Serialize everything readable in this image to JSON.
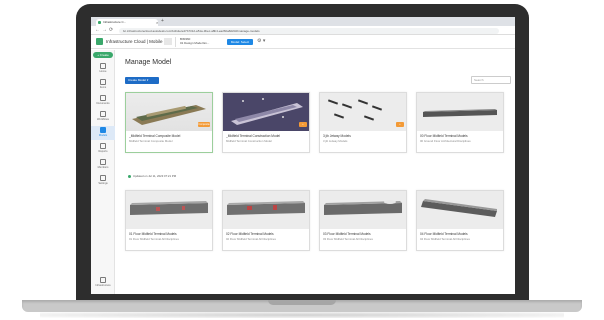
{
  "browser": {
    "tab_title": "Infrastructure C...",
    "tab_close": "×",
    "new_tab": "+",
    "nav_back": "←",
    "nav_forward": "→",
    "nav_reload": "⟳",
    "url": "bc.infrastructurecloud.autodesk.com/bd/site/e47b7312-a51a-3bec-a8b4-ea26ba8d23d/manage-models"
  },
  "app": {
    "name": "Infrastructure Cloud | Mobile",
    "project_name": "BIM360",
    "project_sub": "01 Design Model Ex...",
    "model_badge": "Model: Select",
    "settings_glyph": "⚙ ▾"
  },
  "sidebar": {
    "create_label": "+ Create",
    "items": [
      {
        "label": "Home",
        "icon": "home-icon"
      },
      {
        "label": "Items",
        "icon": "items-icon"
      },
      {
        "label": "Documents",
        "icon": "documents-icon"
      },
      {
        "label": "Workflows",
        "icon": "workflow-icon"
      },
      {
        "label": "Models",
        "icon": "models-icon",
        "active": true
      },
      {
        "label": "Reports",
        "icon": "reports-icon"
      },
      {
        "label": "Members",
        "icon": "members-icon"
      },
      {
        "label": "Settings",
        "icon": "settings-icon"
      }
    ],
    "footer_label": "Infrastructure"
  },
  "main": {
    "title": "Manage Model",
    "action_label": "Create Model ▾",
    "search_placeholder": "Search",
    "updated_text": "Updated on Jul 11, 2023 07:21 PM",
    "cards": [
      {
        "title": "_Midfield Terminal Composite Model",
        "subtitle": "Midfield Terminal Composite Model",
        "badge": "Composite"
      },
      {
        "title": "_Midfield Terminal Construction Model",
        "subtitle": "Midfield Terminal Construction Model",
        "badge": "+"
      },
      {
        "title": "3 jib Jetway Models",
        "subtitle": "3 jib Jetway Models",
        "badge": "+"
      },
      {
        "title": "00 Floor Midfield Terminal Models",
        "subtitle": "00 Ground Floor Architectural Disciplines",
        "badge": ""
      },
      {
        "title": "01 Floor Midfield Terminal Models",
        "subtitle": "01 Floor Midfield Terminal All Disciplines",
        "badge": ""
      },
      {
        "title": "02 Floor Midfield Terminal Models",
        "subtitle": "02 Floor Midfield Terminal All Disciplines",
        "badge": ""
      },
      {
        "title": "03 Floor Midfield Terminal Models",
        "subtitle": "03 Floor Midfield Terminal All Disciplines",
        "badge": ""
      },
      {
        "title": "04 Floor Midfield Terminal Models",
        "subtitle": "04 Floor Midfield Terminal All Disciplines",
        "badge": ""
      }
    ]
  },
  "colors": {
    "laptop_frame": "#2d2d2d",
    "accent_green": "#3aa86b",
    "accent_blue": "#1e6cc6",
    "badge_orange": "#f39a36"
  }
}
